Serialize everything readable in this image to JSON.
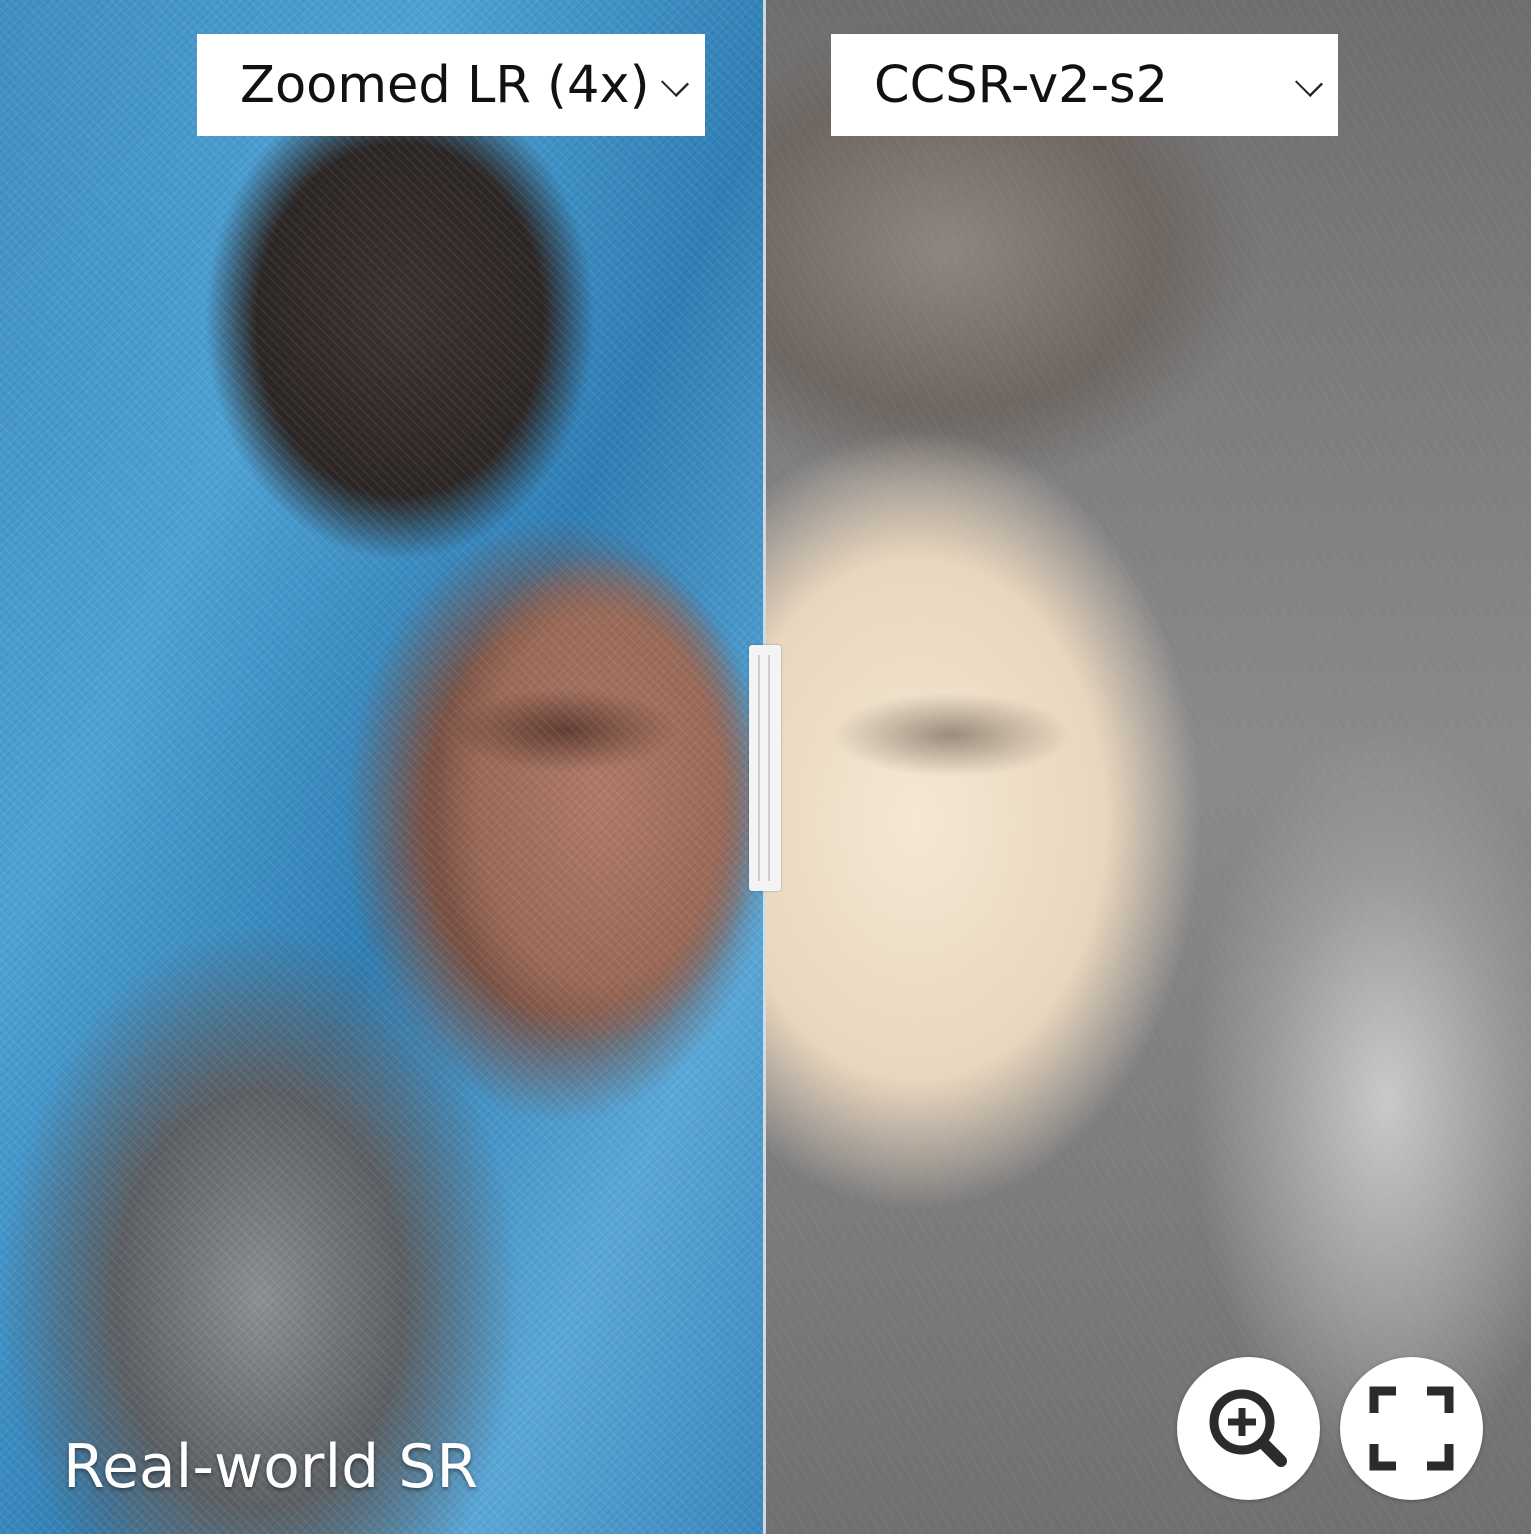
{
  "comparison": {
    "left_select": {
      "value": "Zoomed LR (4x)"
    },
    "right_select": {
      "value": "CCSR-v2-s2"
    },
    "caption": "Real-world SR"
  },
  "controls": {
    "zoom_icon": "zoom-in-icon",
    "fullscreen_icon": "fullscreen-icon",
    "divider_icon": "drag-handle-icon"
  },
  "colors": {
    "background_left": "#3f8fc4",
    "control_bg": "#ffffff",
    "icon_color": "#2b2b2b"
  }
}
